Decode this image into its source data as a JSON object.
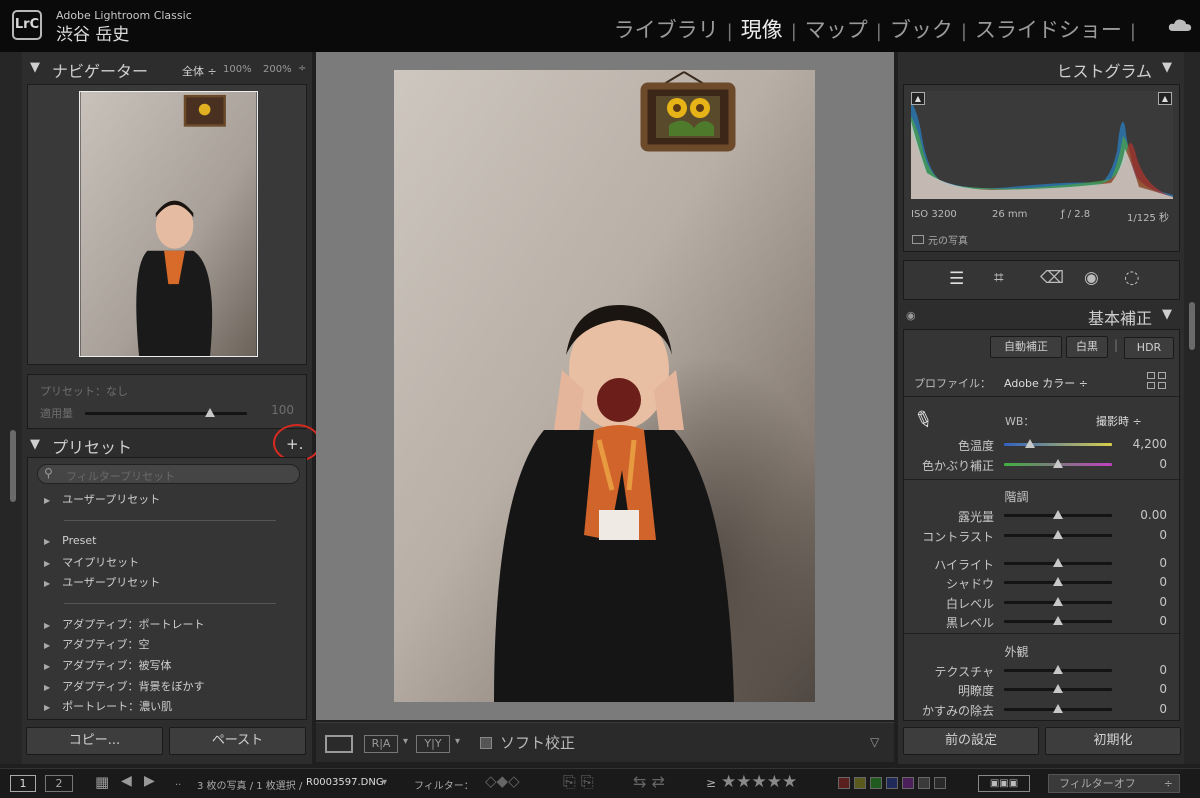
{
  "app": {
    "name": "Adobe Lightroom Classic",
    "logo": "LrC",
    "user": "渋谷 岳史"
  },
  "modules": {
    "items": [
      "ライブラリ",
      "現像",
      "マップ",
      "ブック",
      "スライドショー"
    ],
    "active": "現像"
  },
  "navigator": {
    "title": "ナビゲーター",
    "zoom_fit": "全体",
    "zoom_100": "100%",
    "zoom_200": "200%"
  },
  "preset_amount": {
    "label": "プリセット：なし",
    "amount_label": "適用量",
    "value": "100",
    "level": 0.77
  },
  "presets": {
    "title": "プリセット",
    "add_button": "+.",
    "filter_placeholder": "フィルタープリセット",
    "groups": [
      "ユーザープリセット",
      "Preset",
      "マイプリセット",
      "ユーザープリセット",
      "アダプティブ：ポートレート",
      "アダプティブ：空",
      "アダプティブ：被写体",
      "アダプティブ：背景をぼかす",
      "ポートレート：濃い肌"
    ]
  },
  "left_buttons": {
    "copy": "コピー...",
    "paste": "ペースト"
  },
  "histogram": {
    "title": "ヒストグラム",
    "iso": "ISO 3200",
    "focal": "26 mm",
    "aperture": "ƒ / 2.8",
    "shutter": "1/125 秒",
    "original_photo": "元の写真"
  },
  "basic": {
    "title": "基本補正",
    "auto": "自動補正",
    "bw": "白黒",
    "hdr": "HDR",
    "profile_label": "プロファイル：",
    "profile_value": "Adobe カラー",
    "wb_label": "WB：",
    "wb_value": "撮影時",
    "temp": {
      "label": "色温度",
      "value": "4,200",
      "level": 0.24
    },
    "tint": {
      "label": "色かぶり補正",
      "value": "0",
      "level": 0.5
    },
    "tone_title": "階調",
    "tone": [
      {
        "label": "露光量",
        "value": "0.00",
        "level": 0.5
      },
      {
        "label": "コントラスト",
        "value": "0",
        "level": 0.5
      },
      {
        "label": "ハイライト",
        "value": "0",
        "level": 0.5
      },
      {
        "label": "シャドウ",
        "value": "0",
        "level": 0.5
      },
      {
        "label": "白レベル",
        "value": "0",
        "level": 0.5
      },
      {
        "label": "黒レベル",
        "value": "0",
        "level": 0.5
      }
    ],
    "presence_title": "外観",
    "presence": [
      {
        "label": "テクスチャ",
        "value": "0",
        "level": 0.5
      },
      {
        "label": "明瞭度",
        "value": "0",
        "level": 0.5
      },
      {
        "label": "かすみの除去",
        "value": "0",
        "level": 0.5
      }
    ]
  },
  "right_buttons": {
    "previous": "前の設定",
    "reset": "初期化"
  },
  "toolbar": {
    "soft_proof": "ソフト校正"
  },
  "filmstrip": {
    "page1": "1",
    "page2": "2",
    "info": "3 枚の写真 / 1 枚選択 /",
    "filename": "R0003597.DNG",
    "filter_label": "フィルター：",
    "filter_off": "フィルターオフ"
  },
  "colors": {
    "annotation": "#d42a1f",
    "panel": "#2d2d2d",
    "canvas": "#7b7b7b"
  }
}
